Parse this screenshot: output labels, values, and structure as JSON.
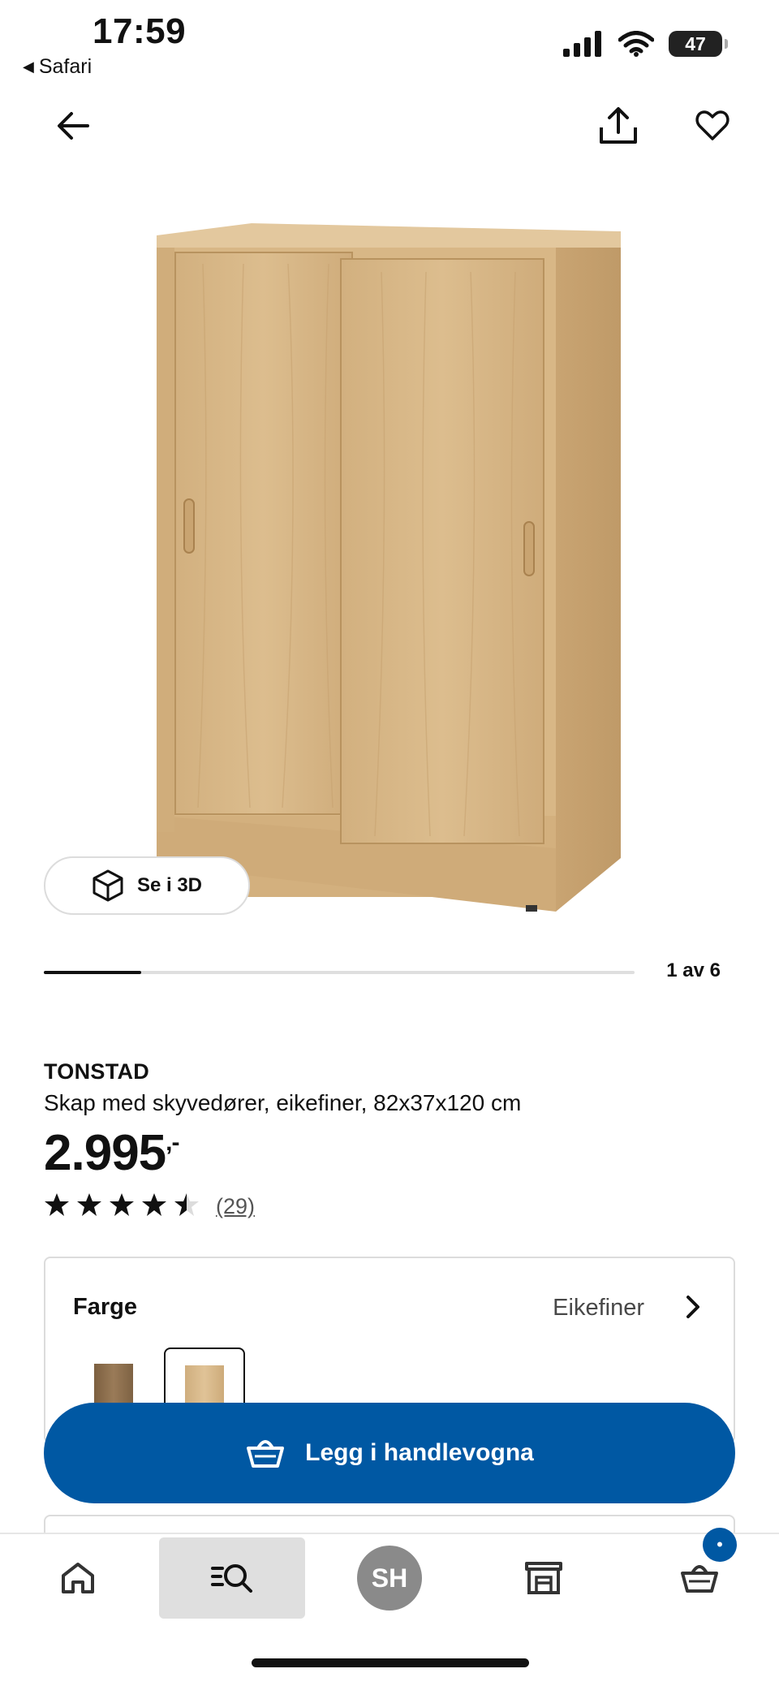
{
  "status_bar": {
    "time": "17:59",
    "back_app": "Safari",
    "battery": "47"
  },
  "top_nav": {
    "back": "arrow-left-icon",
    "share": "share-icon",
    "favorite": "heart-icon"
  },
  "gallery": {
    "view_3d_label": "Se i 3D",
    "position_label": "1 av 6",
    "progress": 0.165
  },
  "product": {
    "name": "TONSTAD",
    "description": "Skap med skyvedører, eikefiner, 82x37x120 cm",
    "price": "2.995",
    "price_suffix": ",-",
    "rating": 4.5,
    "rating_max": 5,
    "review_count": "(29)"
  },
  "color_selector": {
    "label": "Farge",
    "selected_value": "Eikefiner",
    "options": [
      {
        "color": "#8b6d4c",
        "selected": false
      },
      {
        "color": "#d6b98a",
        "selected": true
      }
    ]
  },
  "cta": {
    "label": "Legg i handlevogna"
  },
  "bottom_nav": {
    "items": [
      "home-icon",
      "search-icon",
      "profile-avatar",
      "store-icon",
      "cart-icon"
    ],
    "avatar_initials": "SH",
    "cart_badge": "•",
    "active": "search-icon"
  },
  "colors": {
    "brand_blue": "#0058a3",
    "text": "#111111"
  }
}
